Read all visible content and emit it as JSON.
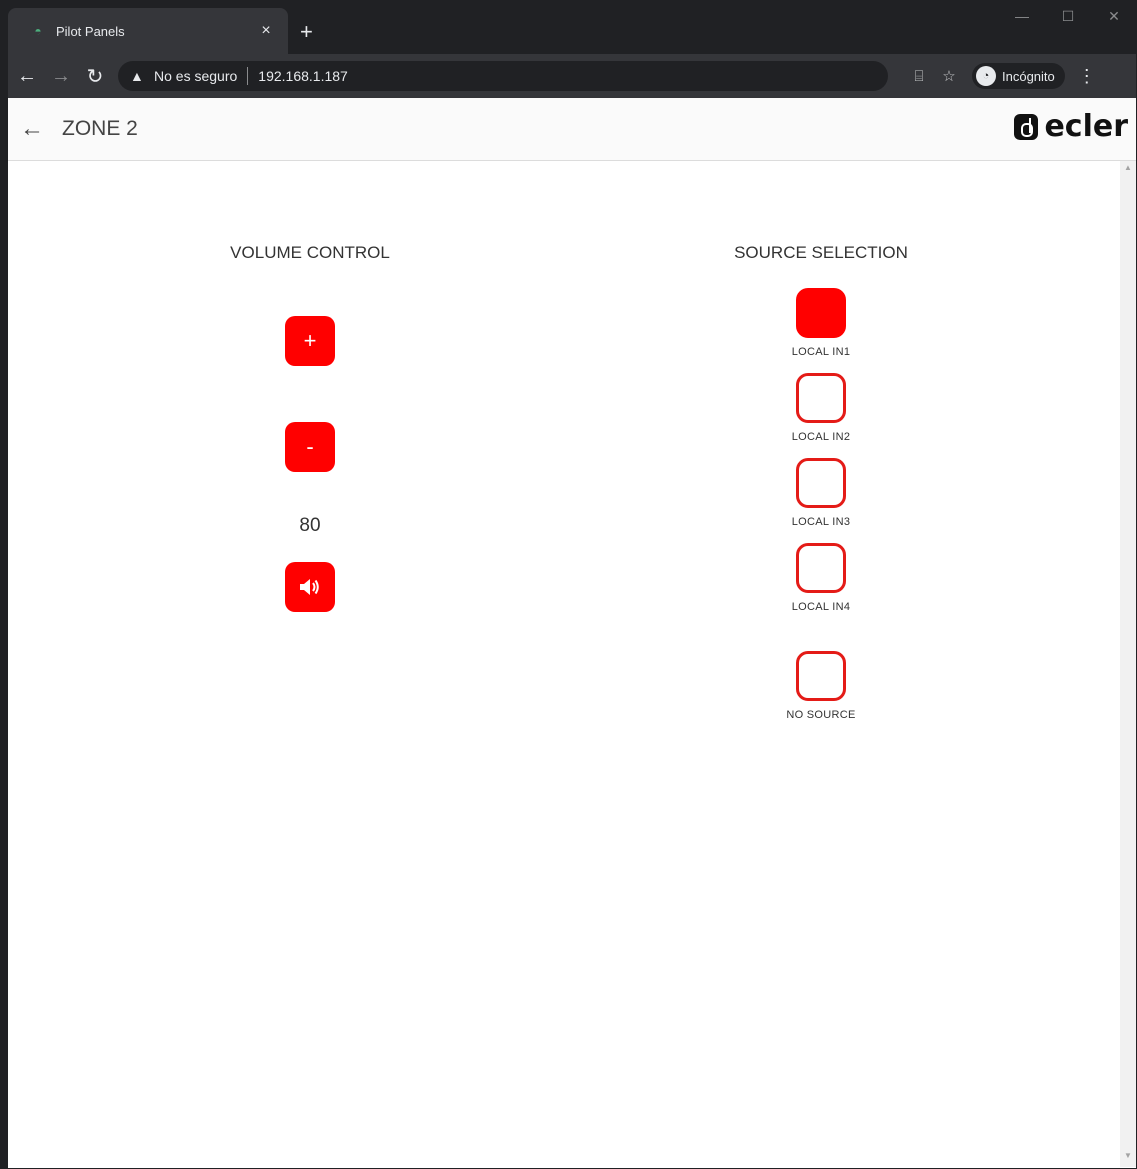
{
  "browser": {
    "tab_title": "Pilot Panels",
    "tab_close": "×",
    "new_tab": "+",
    "address_warning": "No es seguro",
    "address_url": "192.168.1.187",
    "incognito_label": "Incógnito"
  },
  "app": {
    "title": "ZONE 2",
    "logo_text": "ecler"
  },
  "volume": {
    "heading": "VOLUME CONTROL",
    "up_label": "+",
    "down_label": "-",
    "value": "80"
  },
  "source": {
    "heading": "SOURCE SELECTION",
    "items": [
      {
        "label": "LOCAL IN1",
        "active": true
      },
      {
        "label": "LOCAL IN2",
        "active": false
      },
      {
        "label": "LOCAL IN3",
        "active": false
      },
      {
        "label": "LOCAL IN4",
        "active": false
      },
      {
        "label": "NO SOURCE",
        "active": false
      }
    ]
  },
  "colors": {
    "accent": "#ff0000",
    "chrome_dark": "#202124",
    "chrome_mid": "#35363a"
  }
}
